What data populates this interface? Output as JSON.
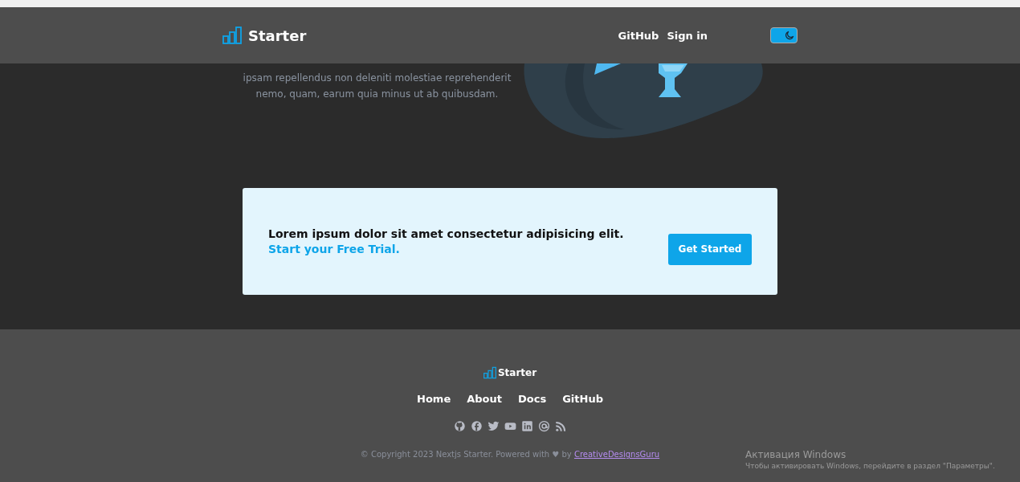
{
  "header": {
    "logo": "Starter",
    "nav": [
      "GitHub",
      "Sign in"
    ],
    "theme_toggle": {
      "on": true
    }
  },
  "hero": {
    "lines": [
      "ipsam repellendus non deleniti molestiae reprehenderit",
      "nemo, quam, earum quia minus ut ab quibusdam."
    ]
  },
  "cta": {
    "text": "Lorem ipsum dolor sit amet consectetur adipisicing elit.",
    "subtext": "Start your Free Trial.",
    "button": "Get Started"
  },
  "footer": {
    "logo": "Starter",
    "nav": [
      "Home",
      "About",
      "Docs",
      "GitHub"
    ],
    "social": [
      {
        "kind": "github"
      },
      {
        "kind": "facebook"
      },
      {
        "kind": "twitter"
      },
      {
        "kind": "youtube"
      },
      {
        "kind": "linkedin"
      },
      {
        "kind": "at"
      },
      {
        "kind": "rss"
      }
    ],
    "copyright": "© Copyright 2023 Nextjs Starter. Powered with ♥ by",
    "author_link": "CreativeDesignsGuru"
  },
  "os_notice": {
    "title": "Активация Windows",
    "text": "Чтобы активировать Windows, перейдите в раздел \"Параметры\"."
  }
}
